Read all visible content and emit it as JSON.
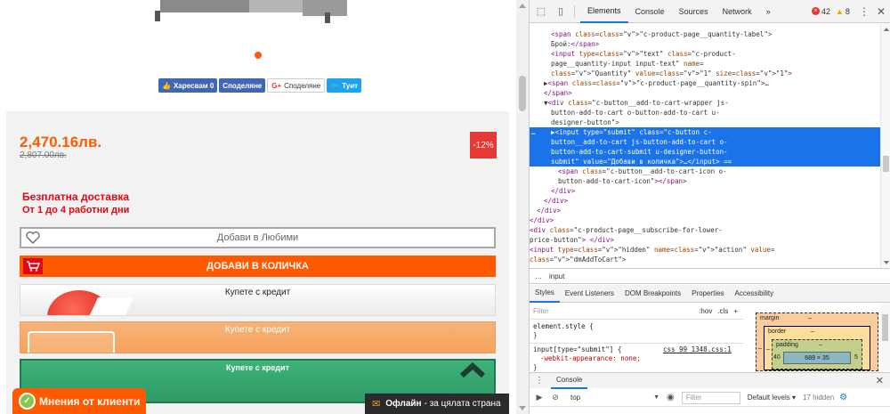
{
  "page": {
    "share": {
      "like_label": "Харесвам 0",
      "share_label": "Споделяне",
      "gplus_icon": "G+",
      "gplus_label": "Споделяне",
      "tweet_label": "Туит"
    },
    "price": "2,470.16лв.",
    "old_price": "2,807.00лв.",
    "discount": "-12%",
    "delivery_title": "Безплатна доставка",
    "delivery_time": "От 1 до 4 работни дни",
    "favorites_label": "Добави в Любими",
    "cart_label": "ДОБАВИ В КОЛИЧКА",
    "credit_1_label": "Купете с кредит",
    "credit_2_label": "Купете с кредит",
    "credit_3_label": "Купете с кредит",
    "reviews_label": "Мнения от клиенти",
    "chat_status": "Офлайн",
    "chat_suffix": "- за цялата страна",
    "colors": {
      "accent": "#ff5a00",
      "delivery": "#e30613",
      "discount_bg": "#e53935"
    }
  },
  "devtools": {
    "tabs": [
      "Elements",
      "Console",
      "Sources",
      "Network",
      "»"
    ],
    "active_tab": "Elements",
    "error_count": "42",
    "warning_count": "8",
    "dom_lines": [
      {
        "indent": 168,
        "html": "<span class=\"c-product-page__quantity-label\">"
      },
      {
        "indent": 168,
        "html": "Брой:</span>"
      },
      {
        "indent": 168,
        "html": "<input type=\"text\" class=\"c-product-"
      },
      {
        "indent": 168,
        "html": "page__quantity-input input-text\" name="
      },
      {
        "indent": 168,
        "html": "\"Quantity\" value=\"1\" size=\"1\">"
      },
      {
        "indent": 160,
        "html": "▶<span class=\"c-product-page__quantity-spin\">…"
      },
      {
        "indent": 160,
        "html": "</span>"
      },
      {
        "indent": 160,
        "html": "▼<div class=\"c-button__add-to-cart-wrapper js-"
      },
      {
        "indent": 168,
        "html": "button-add-to-cart o-button-add-to-cart u-"
      },
      {
        "indent": 168,
        "html": "designer-button\">"
      },
      {
        "indent": 168,
        "html": "▶<input type=\"submit\" class=\"c-button c-"
      },
      {
        "indent": 168,
        "html": "button__add-to-cart js-button-add-to-cart o-"
      },
      {
        "indent": 168,
        "html": "button-add-to-cart-submit u-designer-button-"
      },
      {
        "indent": 168,
        "html": "submit\" value=\"Добави в количка\">…</input> =="
      },
      {
        "indent": 176,
        "html": "<span class=\"c-button__add-to-cart-icon o-"
      },
      {
        "indent": 176,
        "html": "button-add-to-cart-icon\"></span>"
      },
      {
        "indent": 168,
        "html": "</div>"
      },
      {
        "indent": 160,
        "html": "</div>"
      },
      {
        "indent": 152,
        "html": "</div>"
      },
      {
        "indent": 144,
        "html": "</div>"
      },
      {
        "indent": 144,
        "html": "<div class=\"c-product-page__subscribe-for-lower-"
      },
      {
        "indent": 144,
        "html": "price-button\"> </div>"
      },
      {
        "indent": 144,
        "html": "<input type=\"hidden\" name=\"action\" value="
      },
      {
        "indent": 144,
        "html": "\"dmAddToCart\">"
      }
    ],
    "selected_dots": "…",
    "breadcrumb_dots": "…",
    "breadcrumb_item": "input",
    "sub_tabs": [
      "Styles",
      "Event Listeners",
      "DOM Breakpoints",
      "Properties",
      "Accessibility"
    ],
    "styles_filter_placeholder": "Filter",
    "styles_hov": ":hov",
    "styles_cls": ".cls",
    "styles_plus": "+",
    "rule_1_selector": "element.style {",
    "rule_1_close": "}",
    "rule_2_selector": "input[type=\"submit\"] {",
    "rule_2_link": "css 99 1348.css:1",
    "rule_2_prop": "-webkit-appearance: none;",
    "rule_2_close": "}",
    "box_margin_label": "margin",
    "box_border_label": "border",
    "box_padding_label": "padding",
    "box_dash": "–",
    "box_left_value": "40",
    "box_right_value": "5",
    "box_content": "689 × 35",
    "drawer_tab": "Console",
    "console_context": "top",
    "console_filter_placeholder": "Filter",
    "console_levels": "Default levels ▾",
    "console_hidden": "17 hidden"
  }
}
